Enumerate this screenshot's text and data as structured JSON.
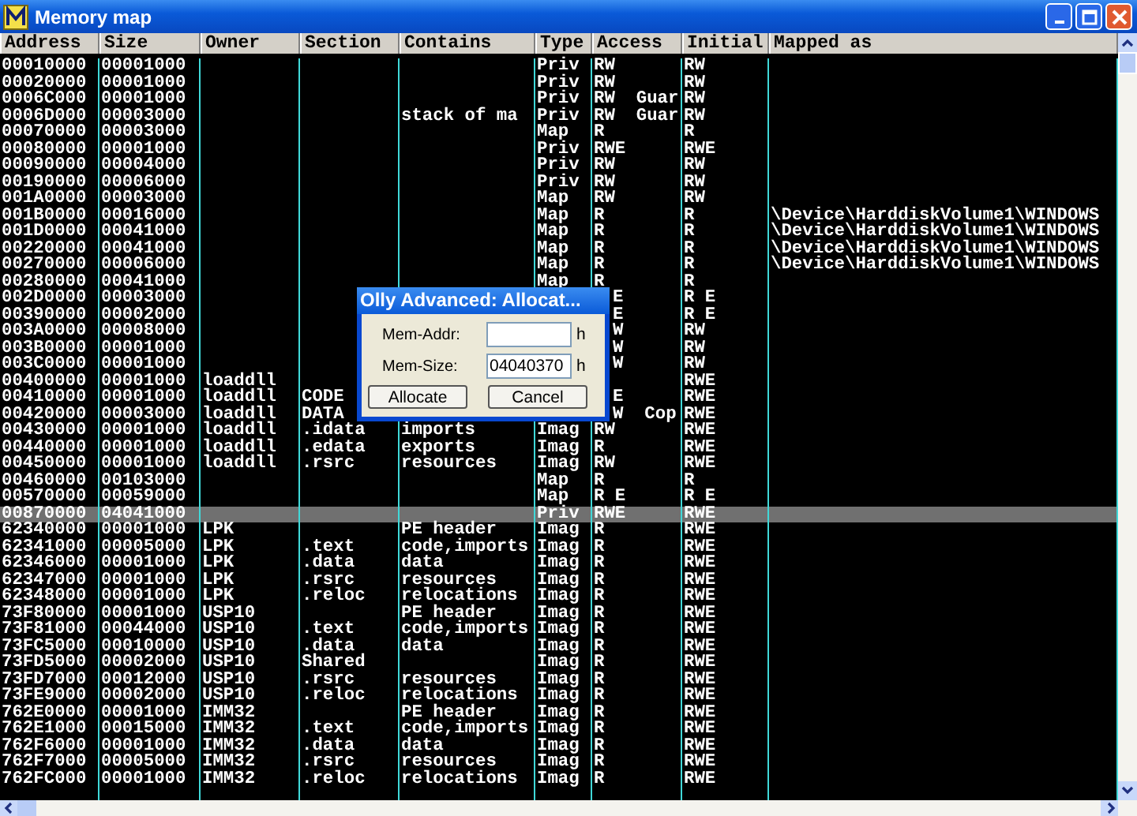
{
  "window": {
    "title": "Memory map"
  },
  "table": {
    "columns": [
      "Address",
      "Size",
      "Owner",
      "Section",
      "Contains",
      "Type",
      "Access",
      "Initial",
      "Mapped as"
    ],
    "rows": [
      {
        "address": "00010000",
        "size": "00001000",
        "type": "Priv",
        "access": "RW",
        "initial": "RW",
        "selected": false,
        "covered": false
      },
      {
        "address": "00020000",
        "size": "00001000",
        "type": "Priv",
        "access": "RW",
        "initial": "RW",
        "selected": false,
        "covered": false
      },
      {
        "address": "0006C000",
        "size": "00001000",
        "type": "Priv",
        "access": "RW  Guar",
        "initial": "RW",
        "selected": false,
        "covered": false
      },
      {
        "address": "0006D000",
        "size": "00003000",
        "contains": "stack of ma",
        "type": "Priv",
        "access": "RW  Guar",
        "initial": "RW",
        "selected": false,
        "covered": false
      },
      {
        "address": "00070000",
        "size": "00003000",
        "type": "Map",
        "access": "R",
        "initial": "R",
        "selected": false,
        "covered": false
      },
      {
        "address": "00080000",
        "size": "00001000",
        "type": "Priv",
        "access": "RWE",
        "initial": "RWE",
        "selected": false,
        "covered": false
      },
      {
        "address": "00090000",
        "size": "00004000",
        "type": "Priv",
        "access": "RW",
        "initial": "RW",
        "selected": false,
        "covered": false
      },
      {
        "address": "00190000",
        "size": "00006000",
        "type": "Priv",
        "access": "RW",
        "initial": "RW",
        "selected": false,
        "covered": false
      },
      {
        "address": "001A0000",
        "size": "00003000",
        "type": "Map",
        "access": "RW",
        "initial": "RW",
        "selected": false,
        "covered": false
      },
      {
        "address": "001B0000",
        "size": "00016000",
        "type": "Map",
        "access": "R",
        "initial": "R",
        "mapped_as": "\\Device\\HarddiskVolume1\\WINDOWS",
        "selected": false,
        "covered": false
      },
      {
        "address": "001D0000",
        "size": "00041000",
        "type": "Map",
        "access": "R",
        "initial": "R",
        "mapped_as": "\\Device\\HarddiskVolume1\\WINDOWS",
        "selected": false,
        "covered": false
      },
      {
        "address": "00220000",
        "size": "00041000",
        "type": "Map",
        "access": "R",
        "initial": "R",
        "mapped_as": "\\Device\\HarddiskVolume1\\WINDOWS",
        "selected": false,
        "covered": false
      },
      {
        "address": "00270000",
        "size": "00006000",
        "type": "Map",
        "access": "R",
        "initial": "R",
        "mapped_as": "\\Device\\HarddiskVolume1\\WINDOWS",
        "selected": false,
        "covered": false
      },
      {
        "address": "00280000",
        "size": "00041000",
        "type": "Map",
        "access": "R",
        "initial": "R",
        "selected": false,
        "covered": false
      },
      {
        "address": "002D0000",
        "size": "00003000",
        "access": "E",
        "initial": "R E",
        "selected": false,
        "covered": true
      },
      {
        "address": "00390000",
        "size": "00002000",
        "access": "E",
        "initial": "R E",
        "selected": false,
        "covered": true
      },
      {
        "address": "003A0000",
        "size": "00008000",
        "access": "W",
        "initial": "RW",
        "selected": false,
        "covered": true
      },
      {
        "address": "003B0000",
        "size": "00001000",
        "access": "W",
        "initial": "RW",
        "selected": false,
        "covered": true
      },
      {
        "address": "003C0000",
        "size": "00001000",
        "access": "W",
        "initial": "RW",
        "selected": false,
        "covered": true
      },
      {
        "address": "00400000",
        "size": "00001000",
        "owner": "loaddll",
        "initial": "RWE",
        "selected": false,
        "covered": true
      },
      {
        "address": "00410000",
        "size": "00001000",
        "owner": "loaddll",
        "section": "CODE",
        "access": "E",
        "initial": "RWE",
        "selected": false,
        "covered": true
      },
      {
        "address": "00420000",
        "size": "00003000",
        "owner": "loaddll",
        "section": "DATA",
        "access": "W  Cop",
        "initial": "RWE",
        "selected": false,
        "covered": true
      },
      {
        "address": "00430000",
        "size": "00001000",
        "owner": "loaddll",
        "section": ".idata",
        "contains": "imports",
        "type": "Imag",
        "access": "RW",
        "initial": "RWE",
        "selected": false,
        "covered": false
      },
      {
        "address": "00440000",
        "size": "00001000",
        "owner": "loaddll",
        "section": ".edata",
        "contains": "exports",
        "type": "Imag",
        "access": "R",
        "initial": "RWE",
        "selected": false,
        "covered": false
      },
      {
        "address": "00450000",
        "size": "00001000",
        "owner": "loaddll",
        "section": ".rsrc",
        "contains": "resources",
        "type": "Imag",
        "access": "RW",
        "initial": "RWE",
        "selected": false,
        "covered": false
      },
      {
        "address": "00460000",
        "size": "00103000",
        "type": "Map",
        "access": "R",
        "initial": "R",
        "selected": false,
        "covered": false
      },
      {
        "address": "00570000",
        "size": "00059000",
        "type": "Map",
        "access": "R E",
        "initial": "R E",
        "selected": false,
        "covered": false
      },
      {
        "address": "00870000",
        "size": "04041000",
        "type": "Priv",
        "access": "RWE",
        "initial": "RWE",
        "selected": true,
        "covered": false
      },
      {
        "address": "62340000",
        "size": "00001000",
        "owner": "LPK",
        "contains": "PE header",
        "type": "Imag",
        "access": "R",
        "initial": "RWE",
        "selected": false,
        "covered": false
      },
      {
        "address": "62341000",
        "size": "00005000",
        "owner": "LPK",
        "section": ".text",
        "contains": "code,imports",
        "type": "Imag",
        "access": "R",
        "initial": "RWE",
        "selected": false,
        "covered": false
      },
      {
        "address": "62346000",
        "size": "00001000",
        "owner": "LPK",
        "section": ".data",
        "contains": "data",
        "type": "Imag",
        "access": "R",
        "initial": "RWE",
        "selected": false,
        "covered": false
      },
      {
        "address": "62347000",
        "size": "00001000",
        "owner": "LPK",
        "section": ".rsrc",
        "contains": "resources",
        "type": "Imag",
        "access": "R",
        "initial": "RWE",
        "selected": false,
        "covered": false
      },
      {
        "address": "62348000",
        "size": "00001000",
        "owner": "LPK",
        "section": ".reloc",
        "contains": "relocations",
        "type": "Imag",
        "access": "R",
        "initial": "RWE",
        "selected": false,
        "covered": false
      },
      {
        "address": "73F80000",
        "size": "00001000",
        "owner": "USP10",
        "contains": "PE header",
        "type": "Imag",
        "access": "R",
        "initial": "RWE",
        "selected": false,
        "covered": false
      },
      {
        "address": "73F81000",
        "size": "00044000",
        "owner": "USP10",
        "section": ".text",
        "contains": "code,imports",
        "type": "Imag",
        "access": "R",
        "initial": "RWE",
        "selected": false,
        "covered": false
      },
      {
        "address": "73FC5000",
        "size": "00010000",
        "owner": "USP10",
        "section": ".data",
        "contains": "data",
        "type": "Imag",
        "access": "R",
        "initial": "RWE",
        "selected": false,
        "covered": false
      },
      {
        "address": "73FD5000",
        "size": "00002000",
        "owner": "USP10",
        "section": "Shared",
        "type": "Imag",
        "access": "R",
        "initial": "RWE",
        "selected": false,
        "covered": false
      },
      {
        "address": "73FD7000",
        "size": "00012000",
        "owner": "USP10",
        "section": ".rsrc",
        "contains": "resources",
        "type": "Imag",
        "access": "R",
        "initial": "RWE",
        "selected": false,
        "covered": false
      },
      {
        "address": "73FE9000",
        "size": "00002000",
        "owner": "USP10",
        "section": ".reloc",
        "contains": "relocations",
        "type": "Imag",
        "access": "R",
        "initial": "RWE",
        "selected": false,
        "covered": false
      },
      {
        "address": "762E0000",
        "size": "00001000",
        "owner": "IMM32",
        "contains": "PE header",
        "type": "Imag",
        "access": "R",
        "initial": "RWE",
        "selected": false,
        "covered": false
      },
      {
        "address": "762E1000",
        "size": "00015000",
        "owner": "IMM32",
        "section": ".text",
        "contains": "code,imports",
        "type": "Imag",
        "access": "R",
        "initial": "RWE",
        "selected": false,
        "covered": false
      },
      {
        "address": "762F6000",
        "size": "00001000",
        "owner": "IMM32",
        "section": ".data",
        "contains": "data",
        "type": "Imag",
        "access": "R",
        "initial": "RWE",
        "selected": false,
        "covered": false
      },
      {
        "address": "762F7000",
        "size": "00005000",
        "owner": "IMM32",
        "section": ".rsrc",
        "contains": "resources",
        "type": "Imag",
        "access": "R",
        "initial": "RWE",
        "selected": false,
        "covered": false
      },
      {
        "address": "762FC000",
        "size": "00001000",
        "owner": "IMM32",
        "section": ".reloc",
        "contains": "relocations",
        "type": "Imag",
        "access": "R",
        "initial": "RWE",
        "selected": false,
        "covered": false
      }
    ]
  },
  "dialog": {
    "title": "Olly Advanced: Allocat...",
    "fields": [
      {
        "label": "Mem-Addr:",
        "unit": "h"
      },
      {
        "label": "Mem-Size:",
        "value": "04040370",
        "unit": "h"
      }
    ],
    "buttons": [
      "Allocate",
      "Cancel"
    ]
  }
}
